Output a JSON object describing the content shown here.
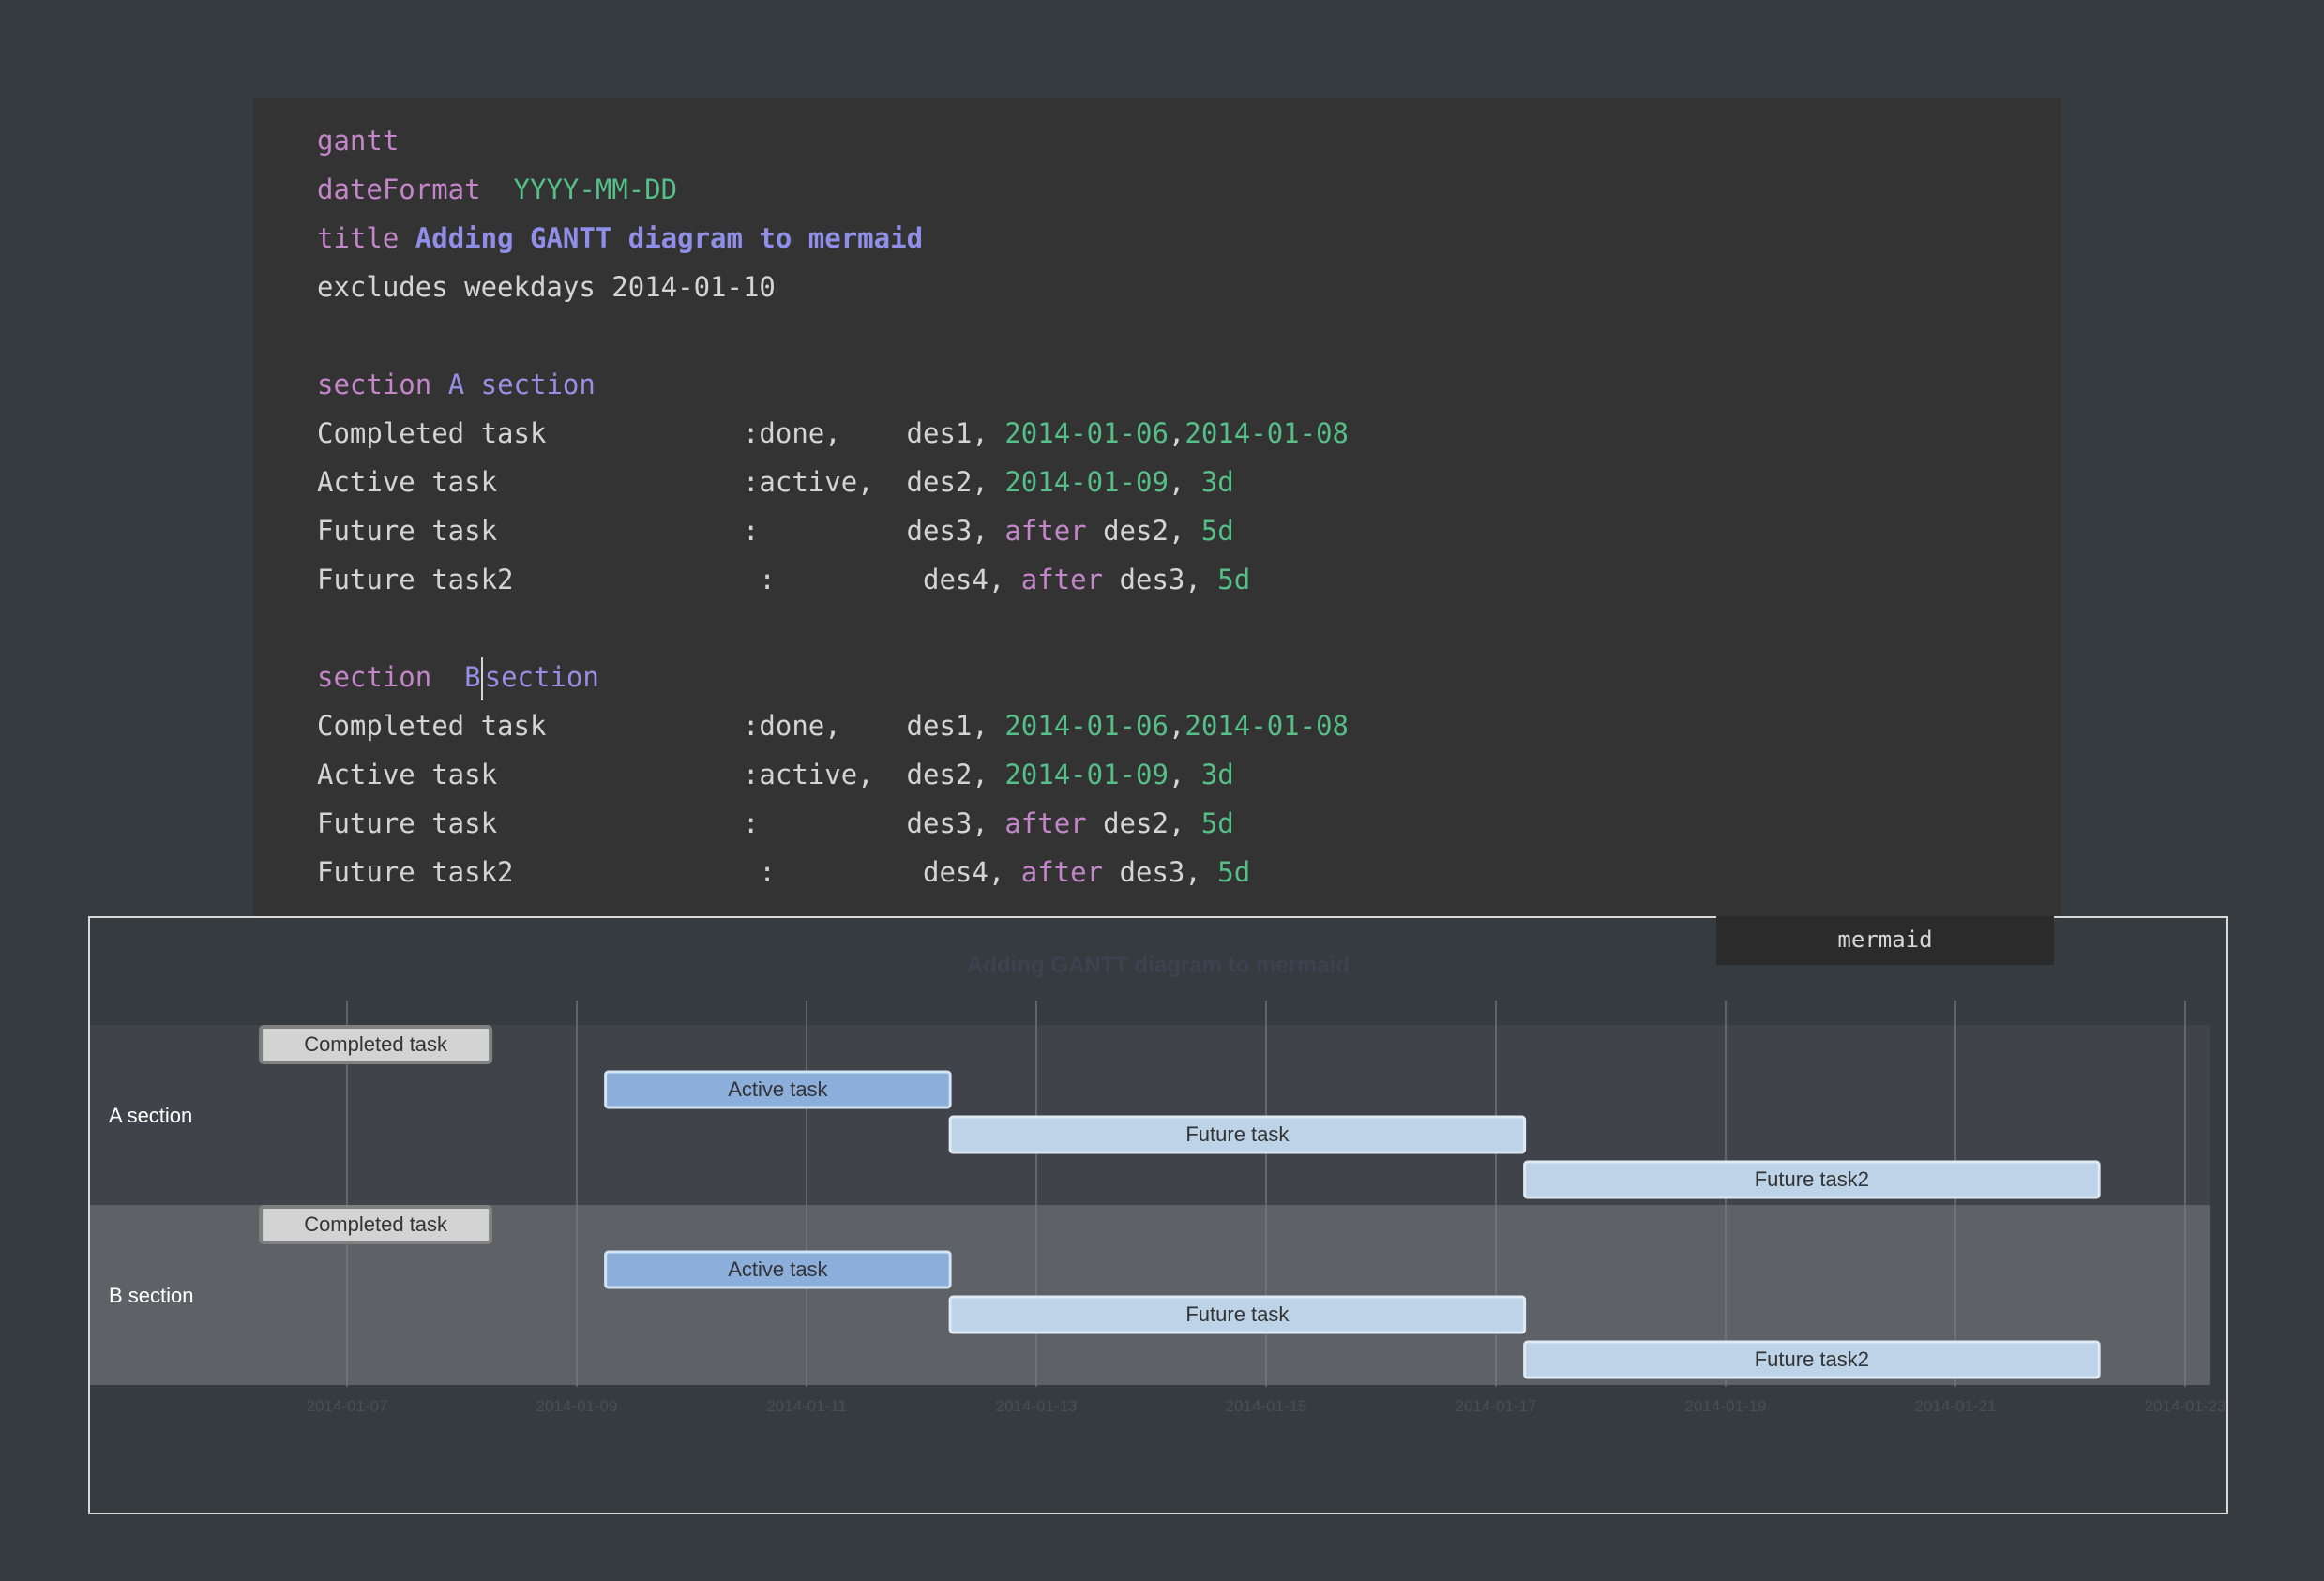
{
  "code": {
    "lines": [
      {
        "parts": [
          {
            "t": "gantt",
            "c": "kw"
          }
        ]
      },
      {
        "parts": [
          {
            "t": "dateFormat",
            "c": "kw"
          },
          {
            "t": "  "
          },
          {
            "t": "YYYY-MM-DD",
            "c": "str"
          }
        ]
      },
      {
        "parts": [
          {
            "t": "title",
            "c": "kw"
          },
          {
            "t": " "
          },
          {
            "t": "Adding GANTT diagram to mermaid",
            "c": "ttl"
          }
        ]
      },
      {
        "parts": [
          {
            "t": "excludes weekdays 2014-01-10"
          }
        ]
      },
      {
        "parts": []
      },
      {
        "parts": [
          {
            "t": "section",
            "c": "kw"
          },
          {
            "t": " "
          },
          {
            "t": "A section",
            "c": "sec"
          }
        ]
      },
      {
        "parts": [
          {
            "t": "Completed task            :done,    des1, "
          },
          {
            "t": "2014-01-06",
            "c": "str"
          },
          {
            "t": ","
          },
          {
            "t": "2014-01-08",
            "c": "str"
          }
        ]
      },
      {
        "parts": [
          {
            "t": "Active task               :active,  des2, "
          },
          {
            "t": "2014-01-09",
            "c": "str"
          },
          {
            "t": ", "
          },
          {
            "t": "3d",
            "c": "str"
          }
        ]
      },
      {
        "parts": [
          {
            "t": "Future task               :         des3, "
          },
          {
            "t": "after",
            "c": "kw"
          },
          {
            "t": " des2, "
          },
          {
            "t": "5d",
            "c": "str"
          }
        ]
      },
      {
        "parts": [
          {
            "t": "Future task2               :         des4, "
          },
          {
            "t": "after",
            "c": "kw"
          },
          {
            "t": " des3, "
          },
          {
            "t": "5d",
            "c": "str"
          }
        ]
      },
      {
        "parts": []
      },
      {
        "parts": [
          {
            "t": "section",
            "c": "kw"
          },
          {
            "t": "  "
          },
          {
            "t": "B",
            "c": "sec"
          },
          {
            "cursor": true
          },
          {
            "t": "section",
            "c": "sec"
          }
        ]
      },
      {
        "parts": [
          {
            "t": "Completed task            :done,    des1, "
          },
          {
            "t": "2014-01-06",
            "c": "str"
          },
          {
            "t": ","
          },
          {
            "t": "2014-01-08",
            "c": "str"
          }
        ]
      },
      {
        "parts": [
          {
            "t": "Active task               :active,  des2, "
          },
          {
            "t": "2014-01-09",
            "c": "str"
          },
          {
            "t": ", "
          },
          {
            "t": "3d",
            "c": "str"
          }
        ]
      },
      {
        "parts": [
          {
            "t": "Future task               :         des3, "
          },
          {
            "t": "after",
            "c": "kw"
          },
          {
            "t": " des2, "
          },
          {
            "t": "5d",
            "c": "str"
          }
        ]
      },
      {
        "parts": [
          {
            "t": "Future task2               :         des4, "
          },
          {
            "t": "after",
            "c": "kw"
          },
          {
            "t": " des3, "
          },
          {
            "t": "5d",
            "c": "str"
          }
        ]
      }
    ]
  },
  "diagram": {
    "tag": "mermaid",
    "title": "Adding GANTT diagram to mermaid",
    "ticks": [
      "2014-01-07",
      "2014-01-09",
      "2014-01-11",
      "2014-01-13",
      "2014-01-15",
      "2014-01-17",
      "2014-01-19",
      "2014-01-21",
      "2014-01-23"
    ],
    "sections": [
      {
        "label": "A section",
        "tasks": [
          {
            "label": "Completed task",
            "status": "done",
            "start_day": 5.5,
            "end_day": 7.5
          },
          {
            "label": "Active task",
            "status": "active",
            "start_day": 8.5,
            "end_day": 11.5
          },
          {
            "label": "Future task",
            "status": "future",
            "start_day": 11.5,
            "end_day": 16.5
          },
          {
            "label": "Future task2",
            "status": "future",
            "start_day": 16.5,
            "end_day": 21.5
          }
        ]
      },
      {
        "label": "B section",
        "tasks": [
          {
            "label": "Completed task",
            "status": "done",
            "start_day": 5.5,
            "end_day": 7.5
          },
          {
            "label": "Active task",
            "status": "active",
            "start_day": 8.5,
            "end_day": 11.5
          },
          {
            "label": "Future task",
            "status": "future",
            "start_day": 11.5,
            "end_day": 16.5
          },
          {
            "label": "Future task2",
            "status": "future",
            "start_day": 16.5,
            "end_day": 21.5
          }
        ]
      }
    ],
    "colors": {
      "done_fill": "#D3D3D3",
      "done_stroke": "#808080",
      "active_fill": "#8CAEDA",
      "active_stroke": "#D3E4F5",
      "future_fill": "#BDD3E8",
      "future_stroke": "#E0EAF4",
      "section_even": "#40444A",
      "section_odd": "#5E6166",
      "grid": "#7A7E84"
    }
  }
}
